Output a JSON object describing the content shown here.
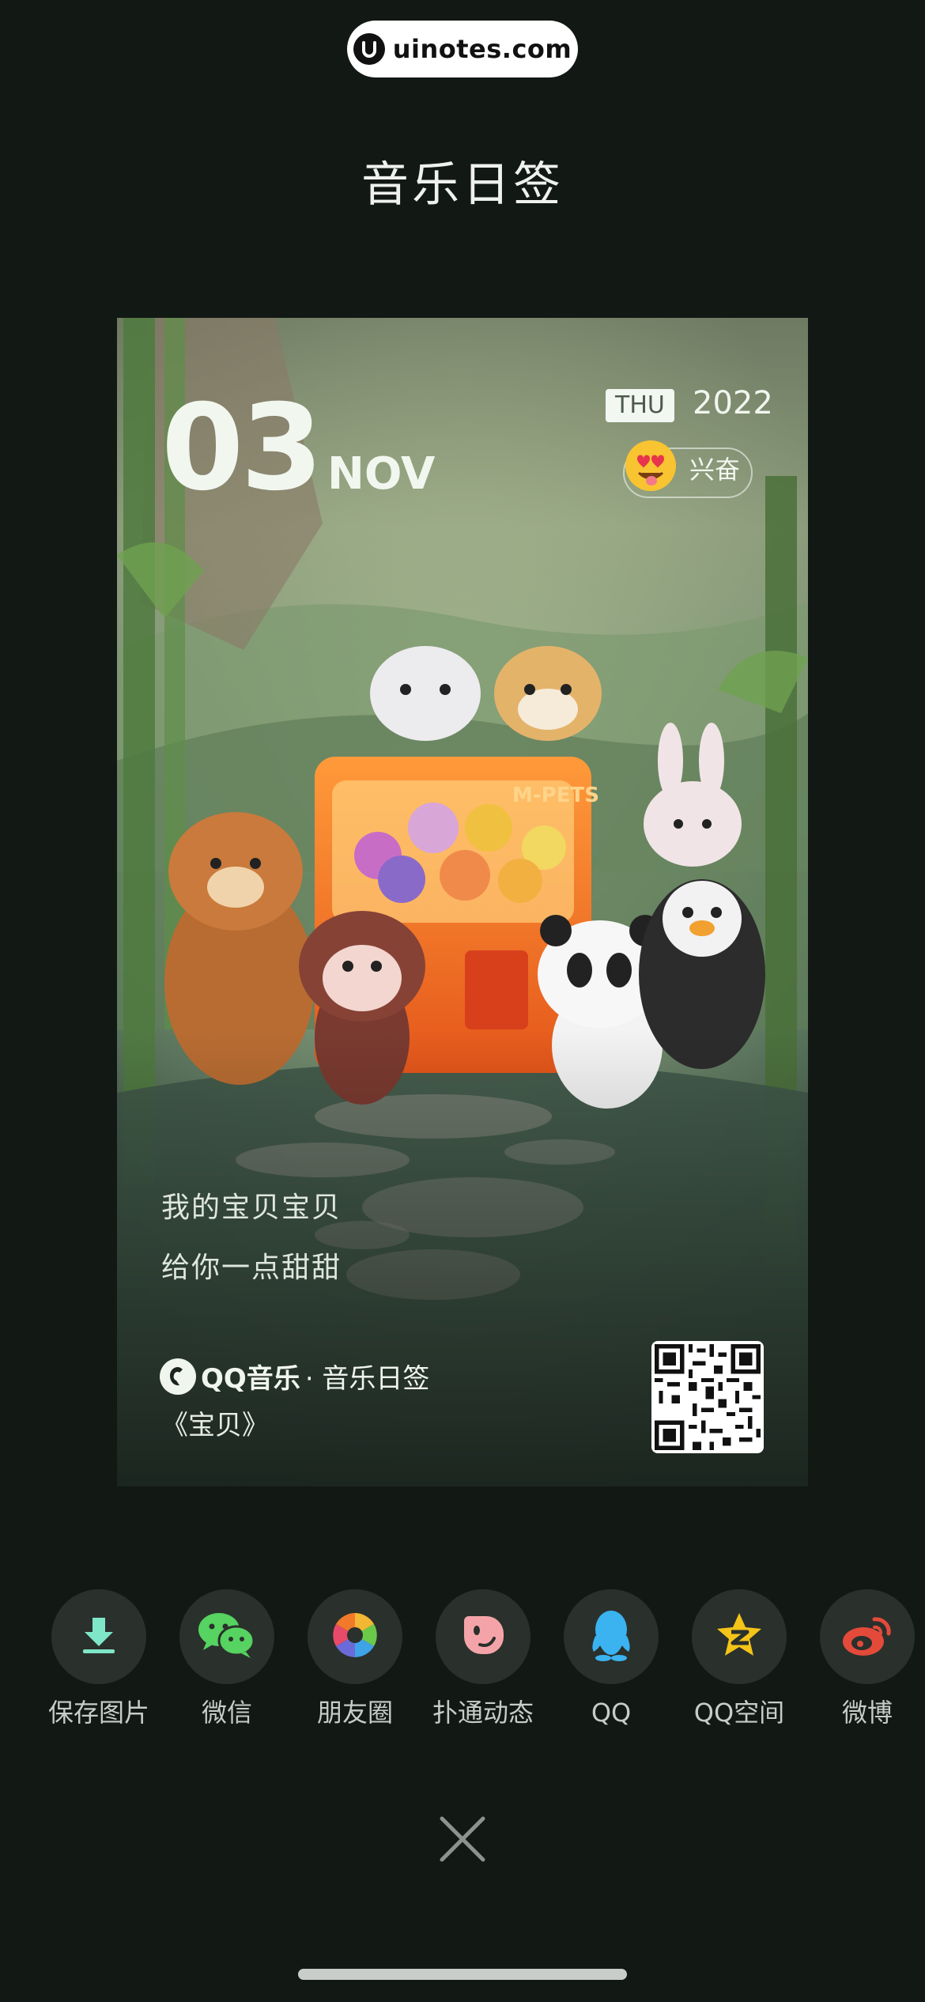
{
  "watermark": {
    "text": "uinotes.com"
  },
  "header": {
    "title": "音乐日签"
  },
  "card": {
    "day": "03",
    "month": "NOV",
    "weekday": "THU",
    "year": "2022",
    "mood": "兴奋",
    "illustration_text": "M-PETS",
    "lyrics": [
      "我的宝贝宝贝",
      "给你一点甜甜"
    ],
    "brand_name": "QQ音乐",
    "brand_sub": "· 音乐日签",
    "song": "《宝贝》"
  },
  "share": {
    "items": [
      {
        "label": "保存图片",
        "icon": "download-icon",
        "color": "#7fe6c8"
      },
      {
        "label": "微信",
        "icon": "wechat-icon",
        "color": "#56d360"
      },
      {
        "label": "朋友圈",
        "icon": "moments-icon",
        "color": "#f2b733"
      },
      {
        "label": "扑通动态",
        "icon": "putong-icon",
        "color": "#f4a4a8"
      },
      {
        "label": "QQ",
        "icon": "qq-icon",
        "color": "#3ab3f0"
      },
      {
        "label": "QQ空间",
        "icon": "qzone-icon",
        "color": "#f4c419"
      },
      {
        "label": "微博",
        "icon": "weibo-icon",
        "color": "#e34a3a"
      }
    ]
  },
  "colors": {
    "background": "#121814",
    "circle": "#2a302c"
  }
}
